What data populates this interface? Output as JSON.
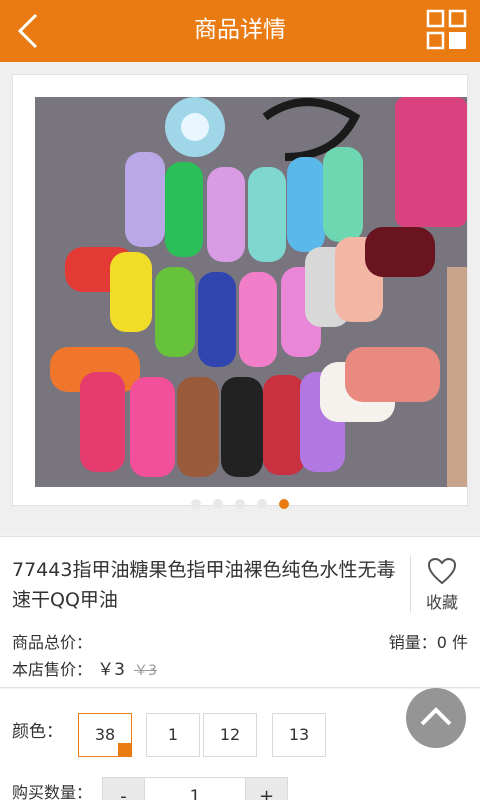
{
  "header": {
    "title": "商品详情",
    "back_icon": "back-arrow-icon",
    "menu_icon": "grid-menu-icon"
  },
  "gallery": {
    "dot_count": 5,
    "active_dot": 5
  },
  "product": {
    "name": "77443指甲油糖果色指甲油裸色纯色水性无毒速干QQ甲油",
    "favorite_label": "收藏",
    "total_price_label": "商品总价：",
    "sales_label": "销量：0 件",
    "store_price_label": "本店售价：",
    "price": "￥3",
    "original_price": "￥3"
  },
  "options": {
    "color_label": "颜色：",
    "colors": [
      "38",
      "1",
      "12",
      "13"
    ],
    "selected_color": "38",
    "quantity_label": "购买数量：",
    "minus": "-",
    "quantity": "1",
    "plus": "+"
  },
  "colors": {
    "brand": "#ea7a12"
  }
}
